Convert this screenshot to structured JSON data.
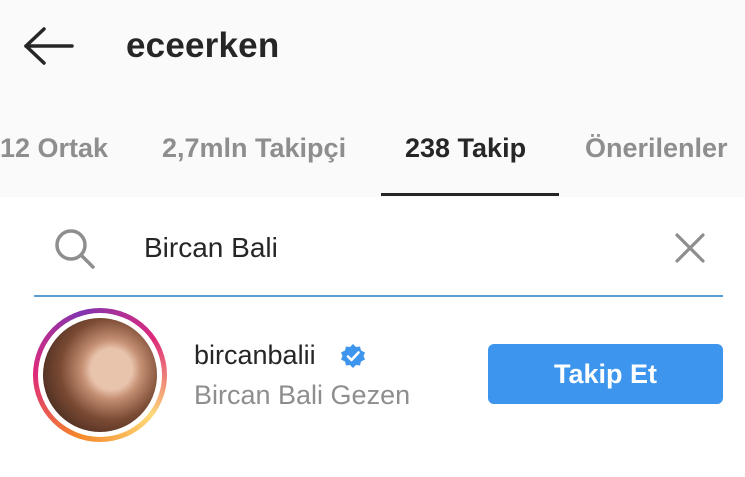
{
  "header": {
    "back_icon": "arrow-left-icon",
    "username": "eceerken"
  },
  "tabs": [
    {
      "label": "12 Ortak"
    },
    {
      "label": "2,7mln Takipçi"
    },
    {
      "label": "238 Takip",
      "active": true
    },
    {
      "label": "Önerilenler"
    }
  ],
  "search": {
    "icon": "search-icon",
    "value": "Bircan Bali",
    "clear_icon": "close-icon",
    "accent_color": "#5a9ed8"
  },
  "result": {
    "username": "bircanbalii",
    "verified_icon": "verified-badge-icon",
    "full_name": "Bircan Bali Gezen",
    "follow_label": "Takip Et",
    "follow_color": "#3d95ee"
  }
}
